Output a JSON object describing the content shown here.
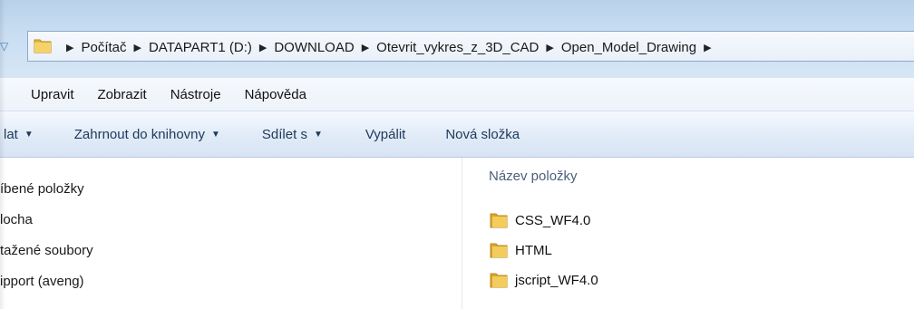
{
  "address": {
    "crumbs": [
      "Počítač",
      "DATAPART1 (D:)",
      "DOWNLOAD",
      "Otevrit_vykres_z_3D_CAD",
      "Open_Model_Drawing"
    ]
  },
  "menu": {
    "items": [
      "Upravit",
      "Zobrazit",
      "Nástroje",
      "Nápověda"
    ]
  },
  "toolbar": {
    "organize_label": "lat",
    "include_label": "Zahrnout do knihovny",
    "share_label": "Sdílet s",
    "burn_label": "Vypálit",
    "new_folder_label": "Nová složka"
  },
  "nav": {
    "items": [
      "íbené položky",
      "locha",
      "tažené soubory",
      "ipport (aveng)"
    ]
  },
  "files": {
    "column_name": "Název položky",
    "items": [
      "CSS_WF4.0",
      "HTML",
      "jscript_WF4.0"
    ]
  },
  "colors": {
    "folder": "#e8b93c",
    "accent": "#1e395b"
  }
}
